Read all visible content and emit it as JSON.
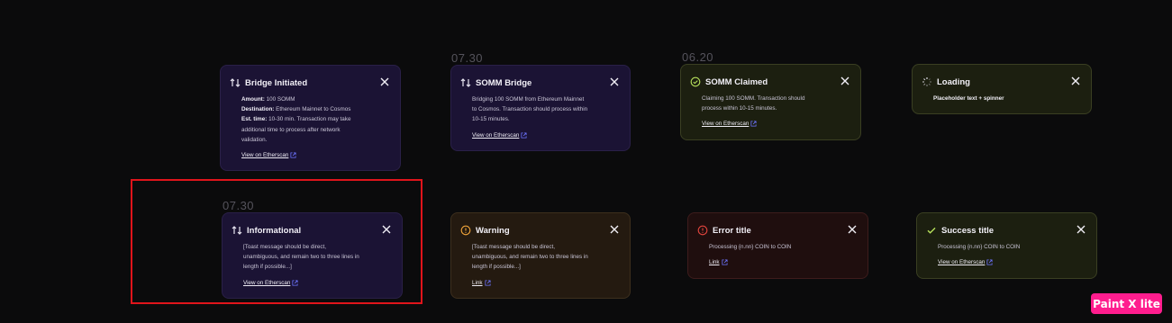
{
  "dates": {
    "d1": "07.30",
    "d2": "06.20",
    "d3": "07.30"
  },
  "colors": {
    "link_icon": "#6d74ff",
    "warning": "#f0a43a",
    "error": "#e2453e",
    "success": "#b6e05b"
  },
  "toasts": {
    "bridge": {
      "title": "Bridge Initiated",
      "amount_label": "Amount:",
      "amount_value": "100 SOMM",
      "dest_label": "Destination:",
      "dest_value": "Ethereum Mainnet to Cosmos",
      "time_label": "Est. time:",
      "time_value": "10-30 min. Transaction may take",
      "time_line2": "additional time to process after network",
      "time_line3": "validation.",
      "link": "View on Etherscan"
    },
    "somm_bridge": {
      "title": "SOMM Bridge",
      "line1": "Bridging 100 SOMM from Ethereum Mainnet",
      "line2": "to Cosmos. Transaction should process within",
      "line3": "10-15 minutes.",
      "link": "View on Etherscan"
    },
    "claimed": {
      "title": "SOMM Claimed",
      "line1": "Claiming 100 SOMM. Transaction should",
      "line2": "process within 10-15 minutes.",
      "link": "View on Etherscan"
    },
    "loading": {
      "title": "Loading",
      "line1": "Placeholder text + spinner"
    },
    "informational": {
      "title": "Informational",
      "line1": "[Toast message should be direct,",
      "line2": "unambiguous, and remain two to three lines in",
      "line3": "length if possible...]",
      "link": "View on Etherscan"
    },
    "warning": {
      "title": "Warning",
      "line1": "[Toast message should be direct,",
      "line2": "unambiguous, and remain two to three lines in",
      "line3": "length if possible...]",
      "link": "Link"
    },
    "error": {
      "title": "Error title",
      "line1": "Processing {n.nn} COIN to COIN",
      "link": "Link"
    },
    "success": {
      "title": "Success title",
      "line1": "Processing {n.nn} COIN to COIN",
      "link": "View on Etherscan"
    }
  },
  "badge": "Paint X lite"
}
